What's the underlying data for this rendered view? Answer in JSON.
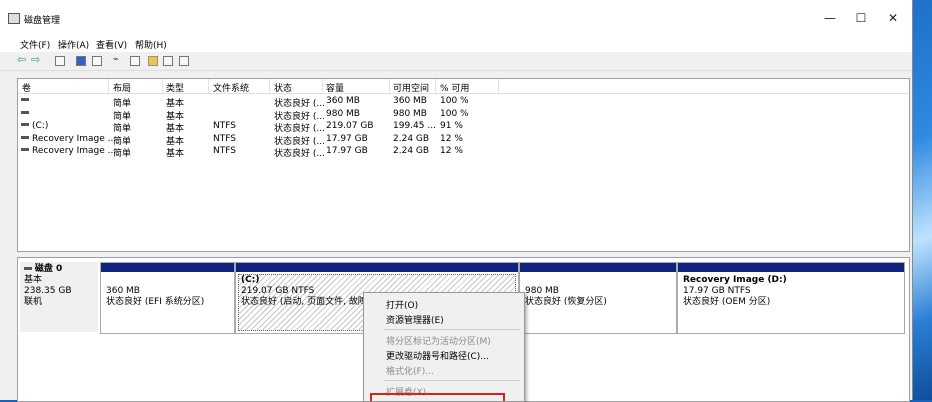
{
  "window": {
    "title": "磁盘管理",
    "buttons": {
      "min": "—",
      "max": "☐",
      "close": "✕"
    }
  },
  "menu": [
    "文件(F)",
    "操作(A)",
    "查看(V)",
    "帮助(H)"
  ],
  "list": {
    "headers": [
      "卷",
      "布局",
      "类型",
      "文件系统",
      "状态",
      "容量",
      "可用空间",
      "% 可用"
    ],
    "rows": [
      {
        "vol": "",
        "layout": "简单",
        "type": "基本",
        "fs": "",
        "status": "状态良好 (...",
        "cap": "360 MB",
        "free": "360 MB",
        "pct": "100 %"
      },
      {
        "vol": "",
        "layout": "简单",
        "type": "基本",
        "fs": "",
        "status": "状态良好 (...",
        "cap": "980 MB",
        "free": "980 MB",
        "pct": "100 %"
      },
      {
        "vol": "(C:)",
        "layout": "简单",
        "type": "基本",
        "fs": "NTFS",
        "status": "状态良好 (...",
        "cap": "219.07 GB",
        "free": "199.45 ...",
        "pct": "91 %"
      },
      {
        "vol": "Recovery Image ...",
        "layout": "简单",
        "type": "基本",
        "fs": "NTFS",
        "status": "状态良好 (...",
        "cap": "17.97 GB",
        "free": "2.24 GB",
        "pct": "12 %"
      },
      {
        "vol": "Recovery Image ...",
        "layout": "简单",
        "type": "基本",
        "fs": "NTFS",
        "status": "状态良好 (...",
        "cap": "17.97 GB",
        "free": "2.24 GB",
        "pct": "12 %"
      }
    ]
  },
  "disk": {
    "name": "磁盘 0",
    "type": "基本",
    "size": "238.35 GB",
    "state": "联机",
    "partitions": [
      {
        "title": "",
        "size": "360 MB",
        "status": "状态良好 (EFI 系统分区)"
      },
      {
        "title": "(C:)",
        "size": "219.07 GB NTFS",
        "status": "状态良好 (启动, 页面文件, 故障转"
      },
      {
        "title": "",
        "size": "980 MB",
        "status": "状态良好 (恢复分区)"
      },
      {
        "title": "Recovery Image  (D:)",
        "size": "17.97 GB NTFS",
        "status": "状态良好 (OEM 分区)"
      }
    ]
  },
  "context_menu": {
    "items": [
      {
        "label": "打开(O)",
        "enabled": true
      },
      {
        "label": "资源管理器(E)",
        "enabled": true
      },
      {
        "label": "将分区标记为活动分区(M)",
        "enabled": false
      },
      {
        "label": "更改驱动器号和路径(C)...",
        "enabled": true
      },
      {
        "label": "格式化(F)...",
        "enabled": false
      },
      {
        "label": "扩展卷(X)...",
        "enabled": false
      }
    ]
  },
  "colors": {
    "partition_band": "#10247f",
    "highlight": "#d9221c"
  }
}
